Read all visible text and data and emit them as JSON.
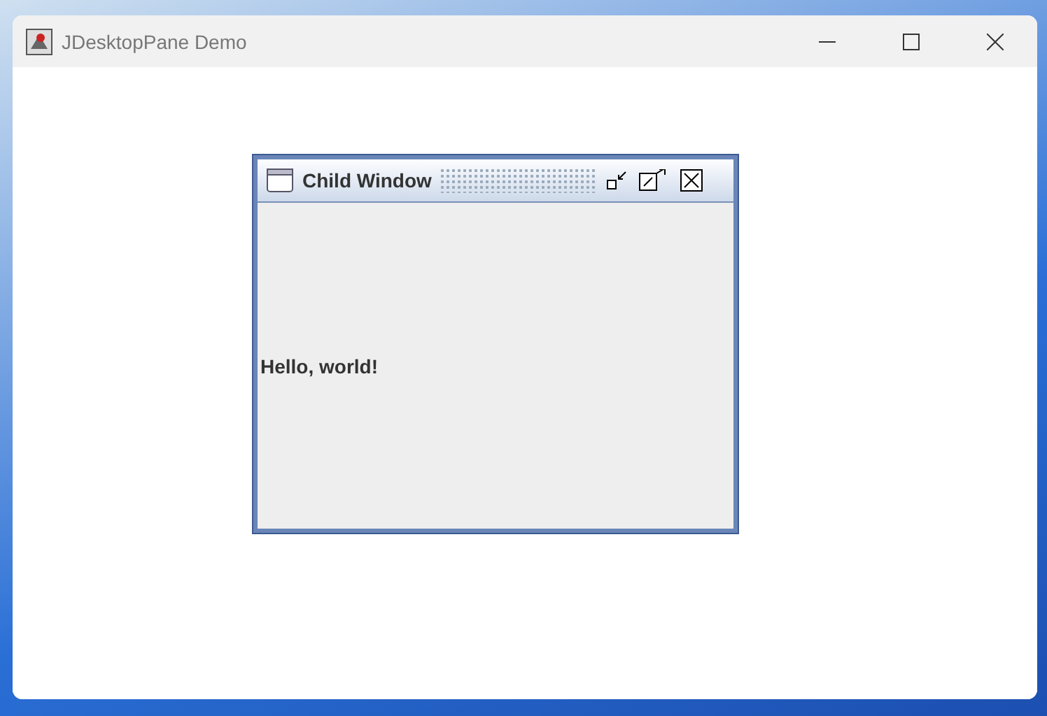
{
  "window": {
    "title": "JDesktopPane Demo"
  },
  "internal_frame": {
    "title": "Child Window",
    "label": "Hello, world!"
  }
}
